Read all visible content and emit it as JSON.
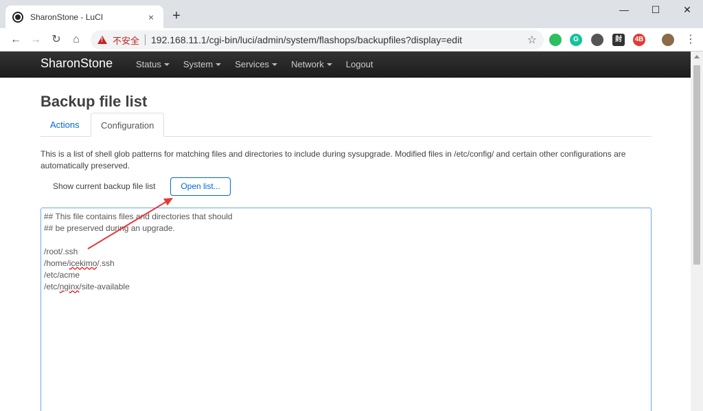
{
  "browser": {
    "tab_title": "SharonStone - LuCI",
    "tab_close": "×",
    "new_tab": "+",
    "insecure_label": "不安全",
    "url": "192.168.11.1/cgi-bin/luci/admin/system/flashops/backupfiles?display=edit",
    "star": "☆",
    "window_controls": {
      "minimize": "—",
      "maximize": "☐",
      "close": "✕"
    },
    "extensions": [
      {
        "name": "evernote-icon",
        "color": "#2dbe60",
        "text": ""
      },
      {
        "name": "grammarly-icon",
        "color": "#15c39a",
        "text": "G"
      },
      {
        "name": "chat-icon",
        "color": "#555555",
        "text": ""
      },
      {
        "name": "seal-icon",
        "color": "#333333",
        "text": "封"
      },
      {
        "name": "red-badge-icon",
        "color": "#e53935",
        "text": "4B"
      },
      {
        "name": "profile-avatar",
        "color": "#8a6b4a",
        "text": ""
      }
    ]
  },
  "luci": {
    "brand": "SharonStone",
    "menu": [
      "Status",
      "System",
      "Services",
      "Network",
      "Logout"
    ]
  },
  "page": {
    "title": "Backup file list",
    "tabs": [
      "Actions",
      "Configuration"
    ],
    "description": "This is a list of shell glob patterns for matching files and directories to include during sysupgrade. Modified files in /etc/config/ and certain other configurations are automatically preserved.",
    "backup_label": "Show current backup file list",
    "open_button": "Open list...",
    "editor_lines": [
      "## This file contains files and directories that should",
      "## be preserved during an upgrade.",
      "",
      "/root/.ssh",
      "/home/icekimo/.ssh",
      "/etc/acme",
      "/etc/nginx/site-available"
    ]
  }
}
